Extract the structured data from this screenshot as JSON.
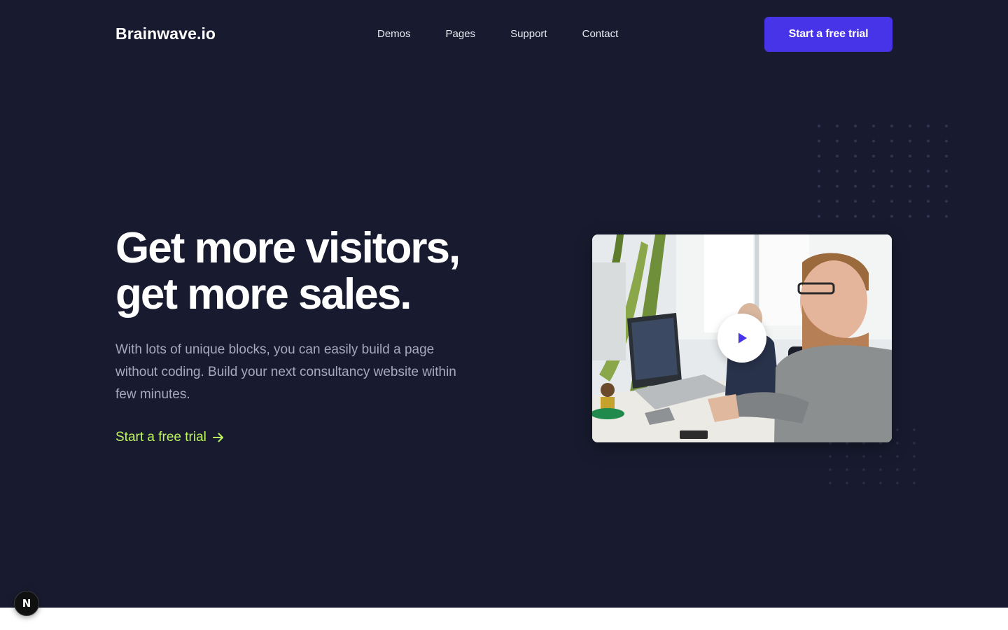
{
  "header": {
    "logo": "Brainwave.io",
    "nav": [
      "Demos",
      "Pages",
      "Support",
      "Contact"
    ],
    "cta_label": "Start a free trial"
  },
  "hero": {
    "headline_line1": "Get more visitors,",
    "headline_line2": "get more sales.",
    "subtext": "With lots of unique blocks, you can easily build a page without coding. Build your next consultancy website within few minutes.",
    "link_label": "Start a free trial",
    "link_icon": "arrow-right-icon",
    "media_icon": "play-icon"
  },
  "devtools": {
    "badge_letter": "N"
  },
  "colors": {
    "background": "#181b2f",
    "accent": "#4733e8",
    "link": "#bdf55e",
    "subtext": "#a6a9bd"
  }
}
